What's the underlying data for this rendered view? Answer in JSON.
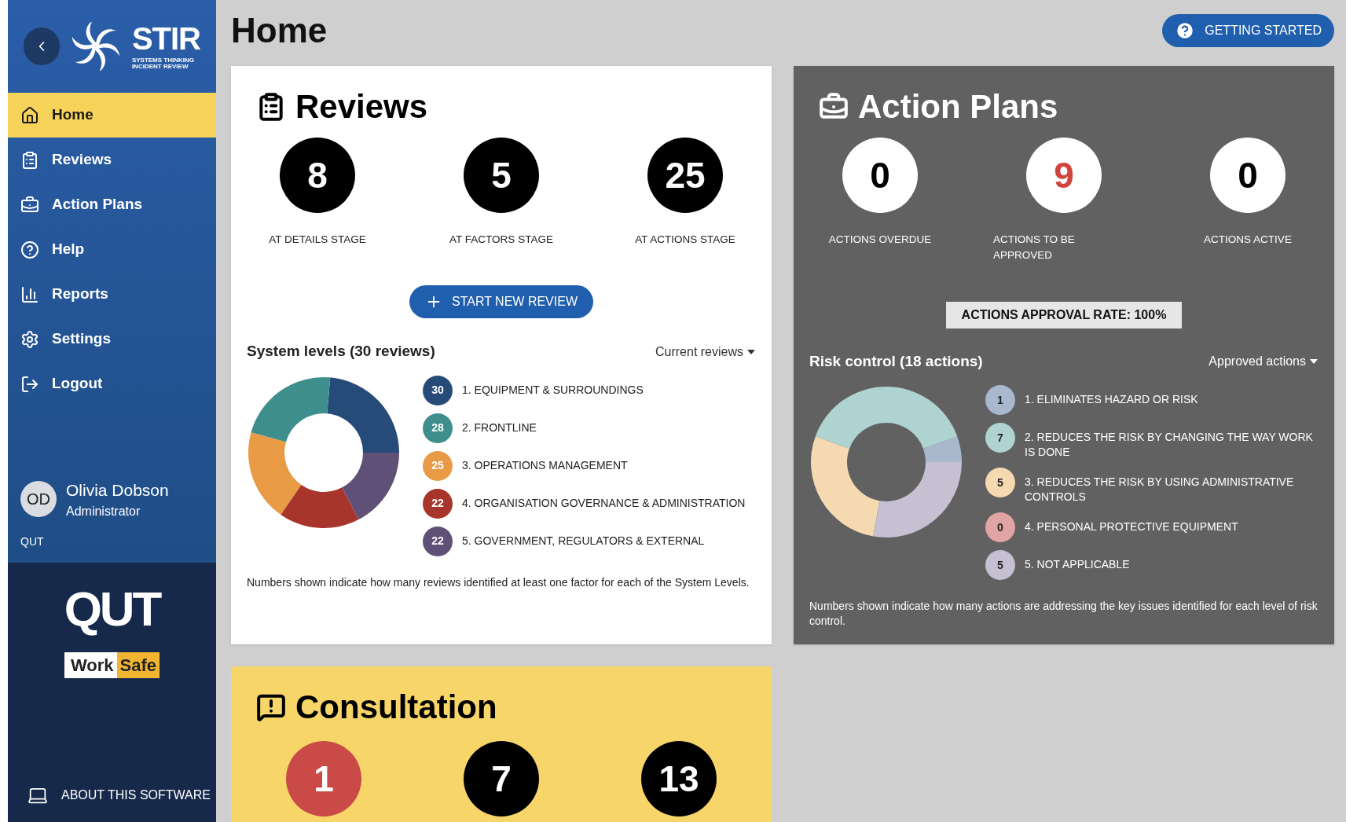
{
  "sidebar": {
    "logo": {
      "name": "STIR",
      "subtitle_1": "SYSTEMS THINKING",
      "subtitle_2": "INCIDENT REVIEW"
    },
    "items": [
      {
        "label": "Home",
        "selected": true
      },
      {
        "label": "Reviews",
        "selected": false
      },
      {
        "label": "Action Plans",
        "selected": false
      },
      {
        "label": "Help",
        "selected": false
      },
      {
        "label": "Reports",
        "selected": false
      },
      {
        "label": "Settings",
        "selected": false
      },
      {
        "label": "Logout",
        "selected": false
      }
    ],
    "user": {
      "initials": "OD",
      "name": "Olivia Dobson",
      "role": "Administrator",
      "organisation": "QUT"
    },
    "partner_logos": {
      "qut": "QUT",
      "worksafe_1": "Work",
      "worksafe_2": "Safe"
    },
    "about": "ABOUT THIS SOFTWARE"
  },
  "header": {
    "title": "Home",
    "button": "GETTING STARTED"
  },
  "reviews": {
    "title": "Reviews",
    "stats": [
      {
        "value": "8",
        "label": "AT DETAILS STAGE"
      },
      {
        "value": "5",
        "label": "AT FACTORS STAGE"
      },
      {
        "value": "25",
        "label": "AT ACTIONS STAGE"
      }
    ],
    "button": "START NEW REVIEW",
    "breakdown_title": "System levels (30 reviews)",
    "filter": "Current reviews",
    "legend": [
      {
        "count": "30",
        "label": "1. EQUIPMENT & SURROUNDINGS",
        "color": "#264b78"
      },
      {
        "count": "28",
        "label": "2. FRONTLINE",
        "color": "#3d8e8c"
      },
      {
        "count": "25",
        "label": "3. OPERATIONS MANAGEMENT",
        "color": "#e89a45"
      },
      {
        "count": "22",
        "label": "4. ORGANISATION GOVERNANCE & ADMINISTRATION",
        "color": "#a8352c"
      },
      {
        "count": "22",
        "label": "5. GOVERNMENT, REGULATORS & EXTERNAL",
        "color": "#5e5077"
      }
    ],
    "note": "Numbers shown indicate how many reviews identified at least one factor for each of the System Levels."
  },
  "action_plans": {
    "title": "Action Plans",
    "stats": [
      {
        "value": "0",
        "label": "ACTIONS OVERDUE",
        "highlight": false
      },
      {
        "value": "9",
        "label": "ACTIONS TO BE APPROVED",
        "highlight": true
      },
      {
        "value": "0",
        "label": "ACTIONS ACTIVE",
        "highlight": false
      }
    ],
    "rate": "ACTIONS APPROVAL RATE: 100%",
    "breakdown_title": "Risk control (18 actions)",
    "filter": "Approved actions",
    "legend": [
      {
        "count": "1",
        "label": "1. ELIMINATES HAZARD OR RISK",
        "color": "#a9b8cc"
      },
      {
        "count": "7",
        "label": "2. REDUCES THE RISK BY CHANGING THE WAY WORK IS DONE",
        "color": "#afd3d1"
      },
      {
        "count": "5",
        "label": "3. REDUCES THE RISK BY USING ADMINISTRATIVE CONTROLS",
        "color": "#f5d9b1"
      },
      {
        "count": "0",
        "label": "4. PERSONAL PROTECTIVE EQUIPMENT",
        "color": "#e0a4a4"
      },
      {
        "count": "5",
        "label": "5. NOT APPLICABLE",
        "color": "#c7bfd2"
      }
    ],
    "note": "Numbers shown indicate how many actions are addressing the key issues identified for each level of risk control."
  },
  "consultation": {
    "title": "Consultation",
    "stats": [
      {
        "value": "1",
        "highlight": true
      },
      {
        "value": "7",
        "highlight": false
      },
      {
        "value": "13",
        "highlight": false
      }
    ]
  }
}
